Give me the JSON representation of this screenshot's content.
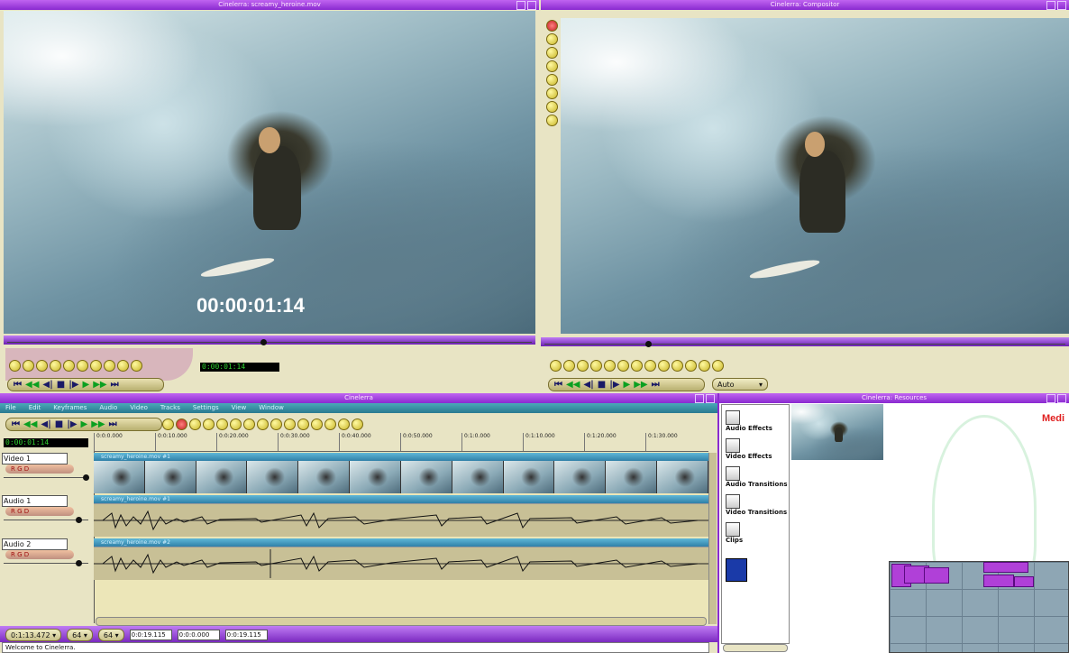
{
  "viewer": {
    "title": "Cinelerra: screamy_heroine.mov",
    "overlay_timecode": "00:00:01:14",
    "lcd": "0:00:01:14"
  },
  "compositor": {
    "title": "Cinelerra: Compositor",
    "zoom": "Auto"
  },
  "main": {
    "title": "Cinelerra",
    "menu": [
      "File",
      "Edit",
      "Keyframes",
      "Audio",
      "Video",
      "Tracks",
      "Settings",
      "View",
      "Window"
    ],
    "lcd": "0:00:01:14",
    "ruler": [
      "0:0:0.000",
      "0:0:10.000",
      "0:0:20.000",
      "0:0:30.000",
      "0:0:40.000",
      "0:0:50.000",
      "0:1:0.000",
      "0:1:10.000",
      "0:1:20.000",
      "0:1:30.000"
    ],
    "tracks": [
      {
        "name": "Video 1",
        "clip": "screamy_heroine.mov #1"
      },
      {
        "name": "Audio 1",
        "clip": "screamy_heroine.mov #1"
      },
      {
        "name": "Audio 2",
        "clip": "screamy_heroine.mov #2"
      }
    ],
    "track_buttons": "R  G  D",
    "bottom": {
      "sample_zoom": "0:1:13.472",
      "amp_zoom": "64",
      "track_zoom": "64",
      "sel_start": "0:0:19.115",
      "sel_length": "0:0:0.000",
      "sel_end": "0:0:19.115"
    },
    "status": "Welcome to Cinelerra."
  },
  "resources": {
    "title": "Cinelerra: Resources",
    "folders": [
      "Audio Effects",
      "Video Effects",
      "Audio Transitions",
      "Video Transitions",
      "Clips"
    ],
    "logo_text": "Medi"
  }
}
